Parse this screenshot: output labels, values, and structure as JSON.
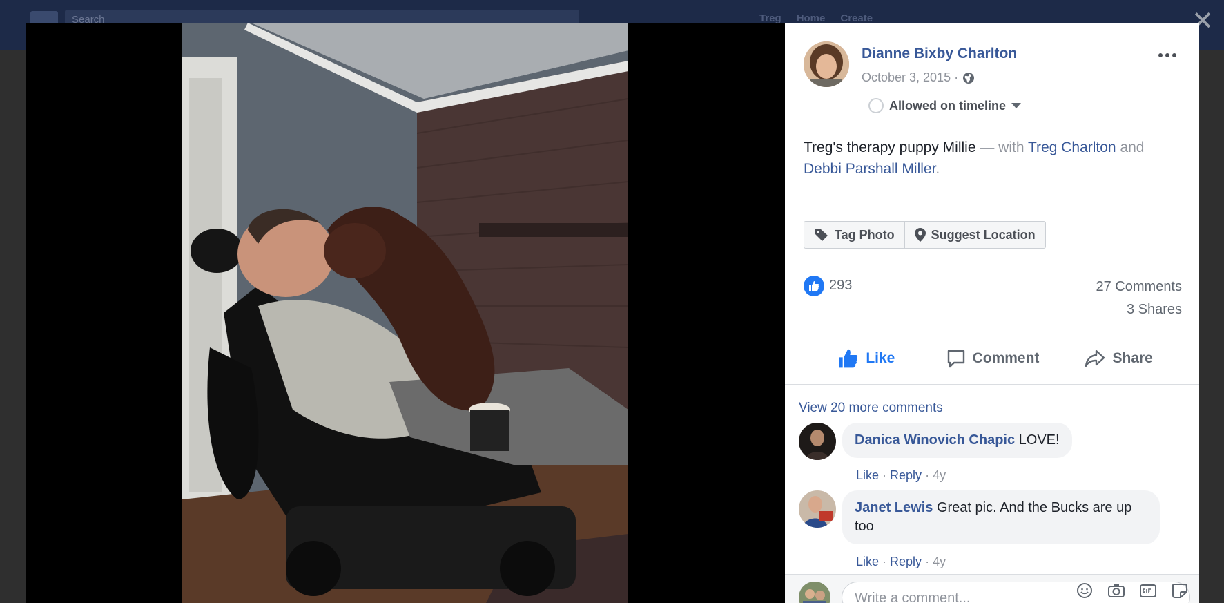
{
  "topbar": {
    "search_placeholder": "Search",
    "nav": [
      "Treg",
      "Home",
      "Create"
    ]
  },
  "close_label": "✕",
  "post": {
    "author": "Dianne Bixby Charlton",
    "date": "October 3, 2015 ·",
    "privacy_icon": "globe-icon",
    "timeline_status": "Allowed on timeline",
    "caption": {
      "text": "Treg's therapy puppy Millie",
      "with": " — with ",
      "tag1": "Treg Charlton",
      "and": " and ",
      "tag2": "Debbi Parshall Miller",
      "end": "."
    },
    "tag_photo": "Tag Photo",
    "suggest_location": "Suggest Location",
    "likes": "293",
    "comments_count": "27 Comments",
    "shares_count": "3 Shares",
    "actions": {
      "like": "Like",
      "comment": "Comment",
      "share": "Share"
    }
  },
  "comments": {
    "view_more": "View 20 more comments",
    "items": [
      {
        "author": "Danica Winovich Chapic",
        "text": "LOVE!",
        "like": "Like",
        "reply": "Reply",
        "age": "4y"
      },
      {
        "author": "Janet Lewis",
        "text": "Great pic. And the Bucks are up too",
        "like": "Like",
        "reply": "Reply",
        "age": "4y"
      }
    ],
    "write_placeholder": "Write a comment..."
  },
  "colors": {
    "link": "#385898",
    "like_blue": "#2078f4",
    "muted": "#90949c"
  }
}
